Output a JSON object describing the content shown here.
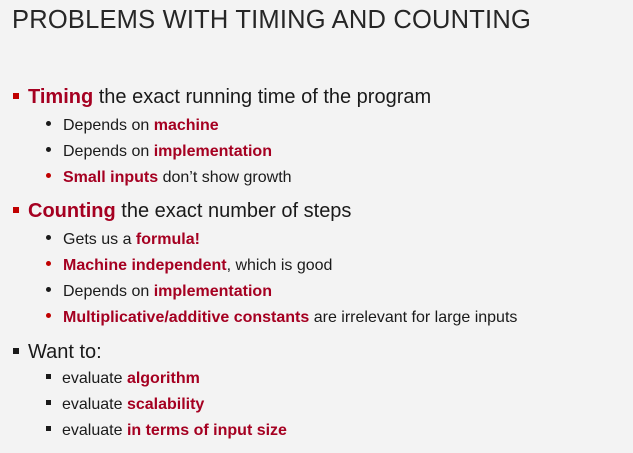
{
  "title": "PROBLEMS WITH TIMING AND COUNTING",
  "colors": {
    "accent": "#a50021",
    "bullet_red": "#c00000",
    "text": "#1a1a1a",
    "background": "#f3f3f3"
  },
  "timing": {
    "head": "Timing",
    "rest": " the exact running time of the program",
    "items": [
      {
        "pre": "Depends on ",
        "hl": "machine",
        "post": ""
      },
      {
        "pre": "Depends on ",
        "hl": "implementation",
        "post": ""
      },
      {
        "pre": "",
        "hl": "Small inputs",
        "post": " don’t show growth"
      }
    ]
  },
  "counting": {
    "head": "Counting",
    "rest": " the exact number of steps",
    "items": [
      {
        "pre": "Gets us a ",
        "hl": "formula!",
        "post": ""
      },
      {
        "pre": "",
        "hl": "Machine independent",
        "post": ", which is good"
      },
      {
        "pre": "Depends on ",
        "hl": "implementation",
        "post": ""
      },
      {
        "pre": "",
        "hl": "Multiplicative/additive constants",
        "post": " are irrelevant for large inputs"
      }
    ]
  },
  "want": {
    "head": "Want to:",
    "items": [
      {
        "pre": "evaluate ",
        "hl": "algorithm"
      },
      {
        "pre": "evaluate ",
        "hl": "scalability"
      },
      {
        "pre": "evaluate ",
        "hl": "in terms of input size"
      }
    ]
  }
}
